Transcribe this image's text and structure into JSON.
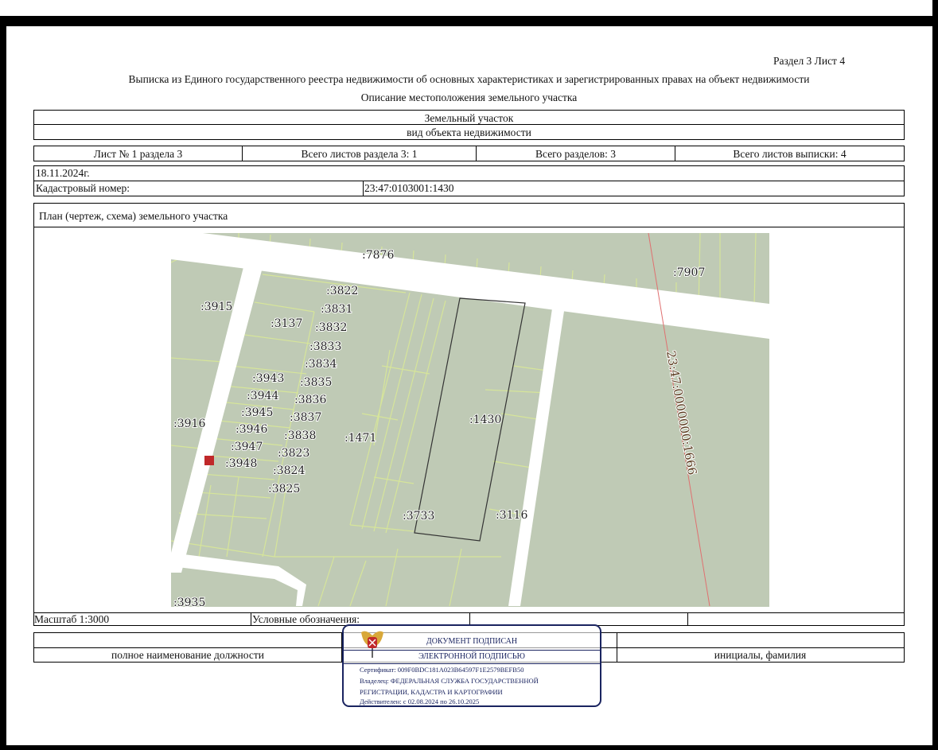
{
  "header": {
    "section_sheet": "Раздел 3    Лист 4",
    "title": "Выписка из Единого государственного реестра недвижимости об основных характеристиках и зарегистрированных правах на объект недвижимости",
    "subtitle": "Описание местоположения земельного участка"
  },
  "object": {
    "name": "Земельный участок",
    "type_caption": "вид объекта недвижимости"
  },
  "sheet_info": [
    "Лист № 1 раздела 3",
    "Всего листов раздела 3: 1",
    "Всего разделов: 3",
    "Всего листов выписки: 4"
  ],
  "date": "18.11.2024г.",
  "cadastral": {
    "label": "Кадастровый номер:",
    "value": "23:47:0103001:1430"
  },
  "plan": {
    "title": "План (чертеж, схема) земельного участка",
    "labels": [
      ":7876",
      ":7907",
      ":3915",
      ":3822",
      ":3831",
      ":3137",
      ":3832",
      ":3833",
      ":3834",
      ":3943",
      ":3835",
      ":3944",
      ":3836",
      ":3945",
      ":3837",
      ":3916",
      ":3946",
      ":3838",
      ":1471",
      ":1430",
      ":3947",
      ":3823",
      ":3948",
      ":3824",
      ":3825",
      ":3733",
      ":3116",
      ":3935"
    ],
    "road_label": "23:47:0000000:1666",
    "colors": {
      "parcel_fill": "#bfcab5",
      "parcel_lines": "#d6e59a",
      "road": "#ffffff",
      "boundary_line": "#e07070",
      "marker": "#c0282a",
      "target_outline": "#333333"
    }
  },
  "footer": {
    "scale": "Масштаб 1:3000",
    "legend_label": "Условные обозначения:",
    "position_caption": "полное наименование должности",
    "name_caption": "инициалы, фамилия"
  },
  "stamp": {
    "line1": "ДОКУМЕНТ ПОДПИСАН",
    "line2": "ЭЛЕКТРОННОЙ ПОДПИСЬЮ",
    "certificate": "Сертификат: 009F0BDC181A023B64597F1E2579BEFB50",
    "owner1": "Владелец: ФЕДЕРАЛЬНАЯ СЛУЖБА ГОСУДАРСТВЕННОЙ",
    "owner2": "РЕГИСТРАЦИИ, КАДАСТРА И КАРТОГРАФИИ",
    "valid": "Действителен: с 02.08.2024 по 26.10.2025",
    "emblem": "coat-of-arms-emblem"
  }
}
